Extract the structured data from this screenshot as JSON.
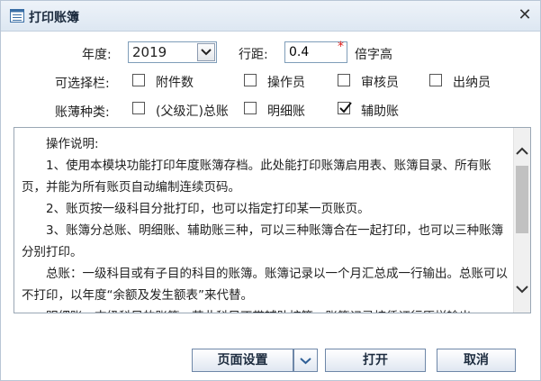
{
  "window": {
    "title": "打印账簿",
    "close_symbol": "✕"
  },
  "year": {
    "label": "年度:",
    "value": "2019"
  },
  "line_spacing": {
    "label": "行距:",
    "value": "0.4",
    "required_mark": "*",
    "unit": "倍字高"
  },
  "optional_columns": {
    "label": "可选择栏:",
    "items": [
      {
        "label": "附件数",
        "checked": false
      },
      {
        "label": "操作员",
        "checked": false
      },
      {
        "label": "审核员",
        "checked": false
      },
      {
        "label": "出纳员",
        "checked": false
      }
    ]
  },
  "ledger_types": {
    "label": "账薄种类:",
    "items": [
      {
        "label": "(父级汇)总账",
        "checked": false
      },
      {
        "label": "明细账",
        "checked": false
      },
      {
        "label": "辅助账",
        "checked": true
      }
    ]
  },
  "instructions": {
    "paragraphs": [
      "操作说明:",
      "1、使用本模块功能打印年度账簿存档。此处能打印账簿启用表、账簿目录、所有账页，并能为所有账页自动编制连续页码。",
      "2、账页按一级科目分批打印，也可以指定打印某一页账页。",
      "3、账簿分总账、明细账、辅助账三种，可以三种账簿合在一起打印，也可以三种账簿分别打印。",
      "总账：一级科目或有子目的科目的账簿。账簿记录以一个月汇总成一行输出。总账可以不打印，以年度“余额及发生额表”来代替。",
      "明细账：末级科目的账簿，若此科目不带辅助核算，账簿记录按凭证行原样输出。"
    ]
  },
  "buttons": {
    "page_setup": "页面设置",
    "print": "打开",
    "cancel": "取消"
  },
  "colors": {
    "accent_border": "#6e87a8",
    "title_bg": "#dde7f2",
    "required": "#e0201c"
  }
}
